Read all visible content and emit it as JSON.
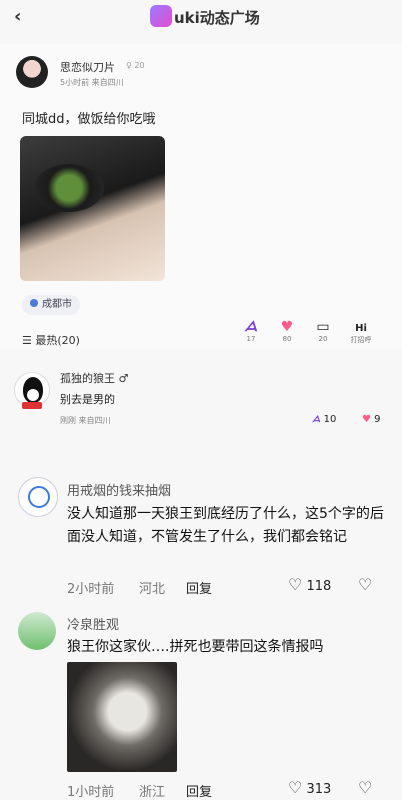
{
  "header": {
    "title": "uki动态广场",
    "back": "‹"
  },
  "post": {
    "author": "思恋似刀片",
    "author_extra": "♀ 20",
    "meta": "5小时前  来自四川",
    "text": "同城dd，做饭给你吃哦",
    "location": "成都市",
    "sort_label": "最热(20)",
    "actions": [
      {
        "icon": "ᗋ",
        "count": "17"
      },
      {
        "icon": "♥",
        "count": "80"
      },
      {
        "icon": "▭",
        "count": "20"
      },
      {
        "icon": "Hi",
        "count": "打招呼"
      }
    ]
  },
  "comment1": {
    "name": "孤独的狼王 ♂",
    "text": "别去是男的",
    "meta": "刚刚  来自四川",
    "mark_count": "10",
    "heart_count": "9"
  },
  "comment2": {
    "name": "用戒烟的钱来抽烟",
    "text": "没人知道那一天狼王到底经历了什么，这5个字的后面没人知道，不管发生了什么，我们都会铭记",
    "time": "2小时前",
    "region": "河北",
    "reply": "回复",
    "likes": "118"
  },
  "comment3": {
    "name": "冷泉胜观",
    "text": "狼王你这家伙….拼死也要带回这条情报吗",
    "time": "1小时前",
    "region": "浙江",
    "reply": "回复",
    "likes": "313"
  }
}
